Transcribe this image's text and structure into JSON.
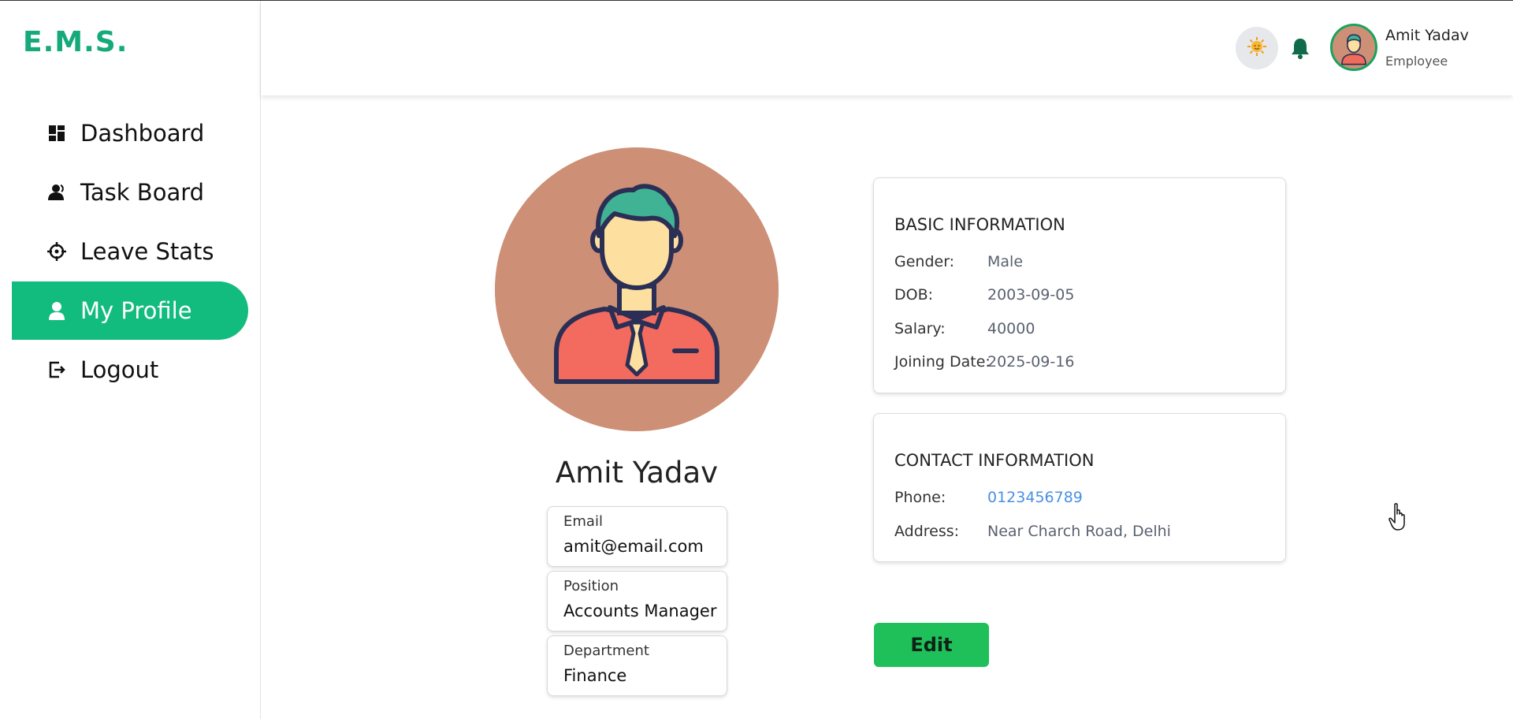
{
  "app": {
    "logo": "E.M.S."
  },
  "sidebar": {
    "items": [
      {
        "label": "Dashboard",
        "icon": "dashboard-icon",
        "active": false
      },
      {
        "label": "Task Board",
        "icon": "users-icon",
        "active": false
      },
      {
        "label": "Leave Stats",
        "icon": "crosshair-icon",
        "active": false
      },
      {
        "label": "My Profile",
        "icon": "user-icon",
        "active": true
      },
      {
        "label": "Logout",
        "icon": "logout-icon",
        "active": false
      }
    ]
  },
  "header": {
    "user_name": "Amit Yadav",
    "user_role": "Employee",
    "theme_icon": "sun-icon",
    "notification_icon": "bell-icon"
  },
  "profile": {
    "name": "Amit Yadav",
    "fields": [
      {
        "label": "Email",
        "value": "amit@email.com"
      },
      {
        "label": "Position",
        "value": "Accounts Manager"
      },
      {
        "label": "Department",
        "value": "Finance"
      }
    ]
  },
  "basic_info": {
    "title": "BASIC INFORMATION",
    "rows": [
      {
        "key": "Gender:",
        "value": "Male"
      },
      {
        "key": "DOB:",
        "value": "2003-09-05"
      },
      {
        "key": "Salary:",
        "value": "40000"
      },
      {
        "key": "Joining Date:",
        "value": "2025-09-16"
      }
    ]
  },
  "contact_info": {
    "title": "CONTACT INFORMATION",
    "rows": [
      {
        "key": "Phone:",
        "value": "0123456789"
      },
      {
        "key": "Address:",
        "value": "Near Charch Road, Delhi"
      }
    ]
  },
  "actions": {
    "edit_label": "Edit"
  },
  "colors": {
    "brand": "#16a97a",
    "active_nav": "#12bb7e",
    "edit_button": "#1fc05a",
    "link": "#4a90e2",
    "avatar_bg": "#cd8f76"
  }
}
